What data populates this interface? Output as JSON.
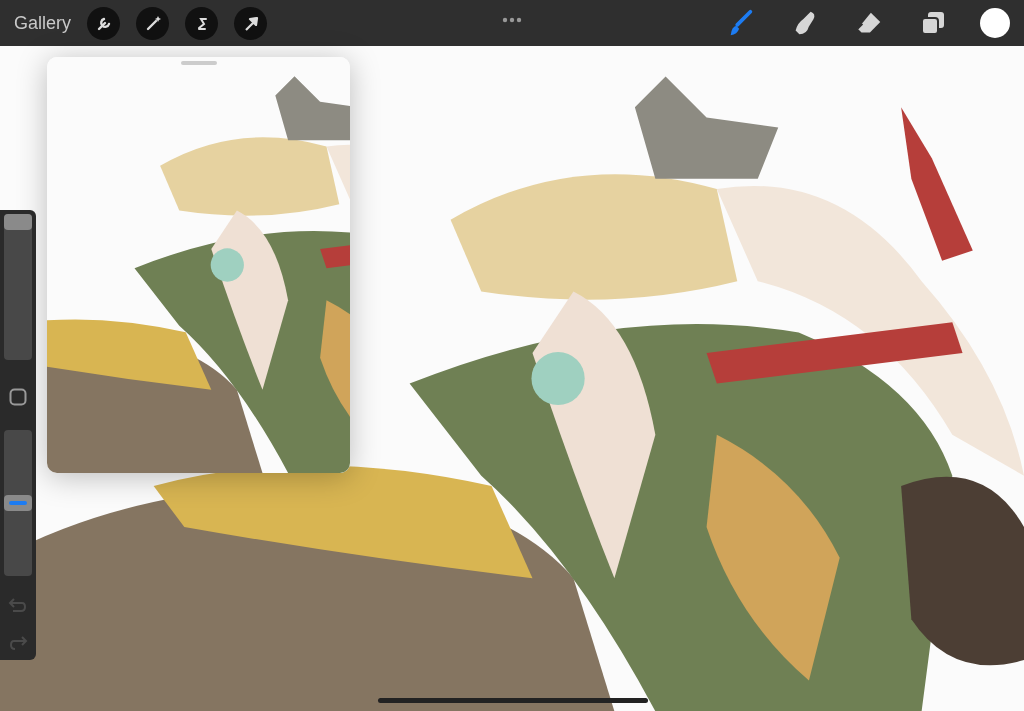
{
  "toolbar": {
    "gallery": "Gallery",
    "tools": [
      {
        "kind": "brush",
        "selected": true
      },
      {
        "kind": "smudge",
        "selected": false
      },
      {
        "kind": "eraser",
        "selected": false
      }
    ]
  },
  "sidebar": {
    "size_slider": {
      "level": 1.0
    },
    "opacity_slider": {
      "level": 0.5
    },
    "undo": {
      "disabled": true
    },
    "redo": {
      "disabled": true
    }
  }
}
